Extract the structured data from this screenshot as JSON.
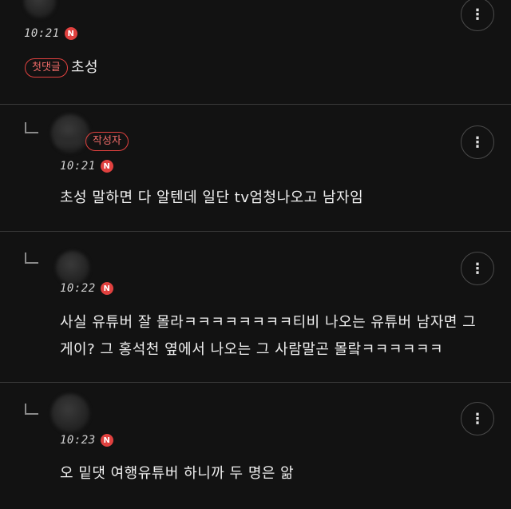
{
  "badges": {
    "new": "N",
    "first_comment": "첫댓글",
    "author": "작성자"
  },
  "more_icon": "⋮",
  "comments": [
    {
      "time": "10:21",
      "text_lines": [
        "초성"
      ]
    },
    {
      "time": "10:21",
      "text_lines": [
        "초성 말하면 다 알텐데 일단 tv엄청나오고 남자임"
      ]
    },
    {
      "time": "10:22",
      "text_lines": [
        "사실 유튜버 잘 몰라ㅋㅋㅋㅋㅋㅋㅋㅋ티비 나오는 유튜버 남자면 그",
        "게이? 그 홍석천 옆에서 나오는 그 사람말곤 몰랔ㅋㅋㅋㅋㅋㅋ"
      ]
    },
    {
      "time": "10:23",
      "text_lines": [
        "오 밑댓 여행유튜버 하니까 두 명은 앎"
      ]
    }
  ]
}
